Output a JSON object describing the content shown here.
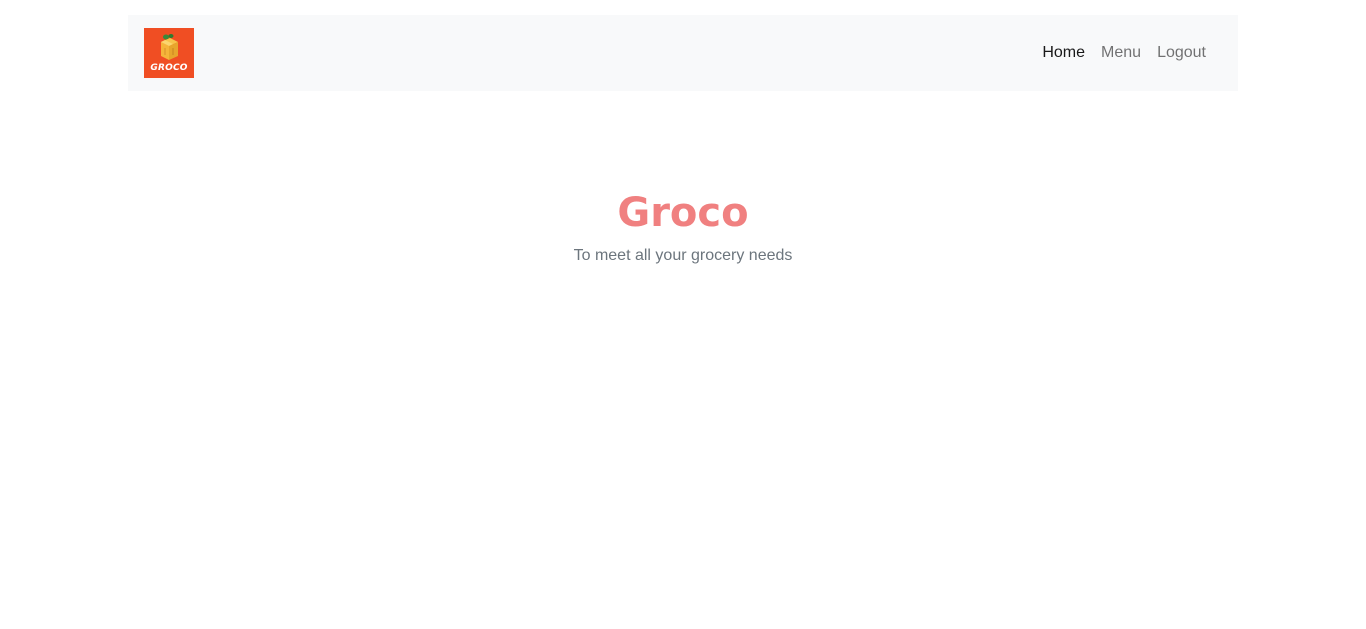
{
  "navbar": {
    "logo_text": "GROCO",
    "logo_icon": "grocery-box-icon",
    "links": [
      {
        "label": "Home",
        "active": true
      },
      {
        "label": "Menu",
        "active": false
      },
      {
        "label": "Logout",
        "active": false
      }
    ]
  },
  "hero": {
    "title": "Groco",
    "subtitle": "To meet all your grocery needs"
  },
  "colors": {
    "brand": "#f04e23",
    "title": "#f08080",
    "navbar_bg": "#f8f9fa",
    "subtitle": "#6c757d"
  }
}
